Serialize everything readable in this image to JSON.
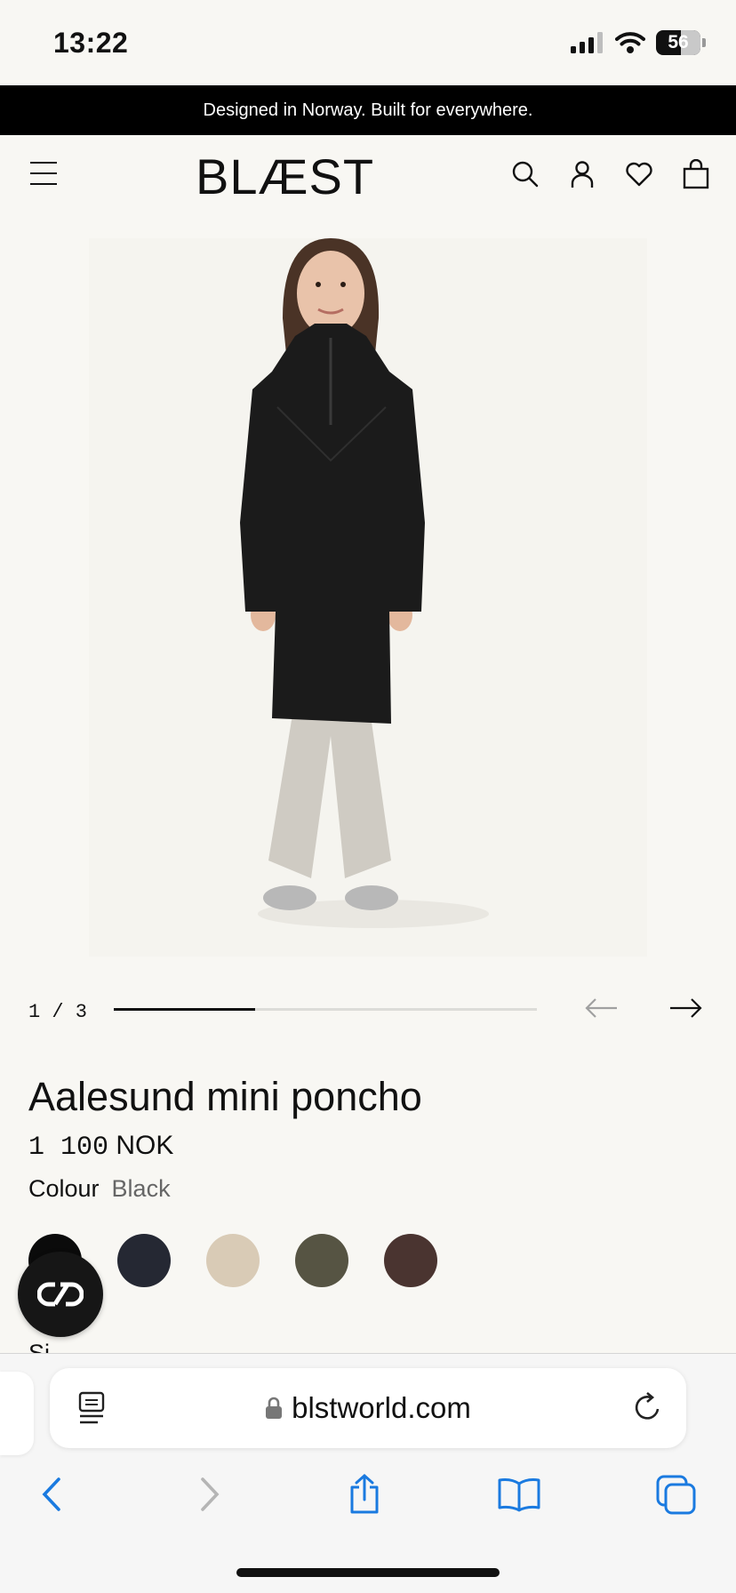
{
  "status_bar": {
    "time": "13:22",
    "battery": "56"
  },
  "promo_bar": {
    "text": "Designed in Norway. Built for everywhere."
  },
  "header": {
    "logo": "BLÆST"
  },
  "carousel": {
    "counter": "1 / 3",
    "progress_fraction": 0.333
  },
  "product": {
    "title": "Aalesund mini poncho",
    "price_amount": "1 100",
    "price_currency": "NOK",
    "colour_label": "Colour",
    "colour_value": "Black",
    "swatches": [
      "#0b0b0b",
      "#252833",
      "#d9cbb6",
      "#565443",
      "#4a3430"
    ],
    "size_label_partial": "Si"
  },
  "browser": {
    "url": "blstworld.com"
  }
}
